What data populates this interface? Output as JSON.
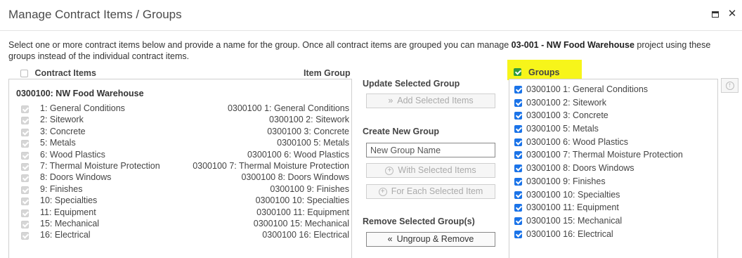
{
  "window": {
    "title": "Manage Contract Items / Groups",
    "maximize_icon": "maximize-icon",
    "close_label": "✕"
  },
  "description": {
    "before": "Select one or more contract items below and provide a name for the group. Once all contract items are grouped you can manage ",
    "project": "03-001 - NW Food Warehouse",
    "after": " project using these groups instead of the individual contract items."
  },
  "left": {
    "header_label": "Contract Items",
    "header_right": "Item Group",
    "group_title": "0300100: NW Food Warehouse",
    "items": [
      {
        "name": "1: General Conditions",
        "group": "0300100 1: General Conditions"
      },
      {
        "name": "2: Sitework",
        "group": "0300100 2: Sitework"
      },
      {
        "name": "3: Concrete",
        "group": "0300100 3: Concrete"
      },
      {
        "name": "5: Metals",
        "group": "0300100 5: Metals"
      },
      {
        "name": "6: Wood Plastics",
        "group": "0300100 6: Wood Plastics"
      },
      {
        "name": "7: Thermal Moisture Protection",
        "group": "0300100 7: Thermal Moisture Protection"
      },
      {
        "name": "8: Doors Windows",
        "group": "0300100 8: Doors Windows"
      },
      {
        "name": "9: Finishes",
        "group": "0300100 9: Finishes"
      },
      {
        "name": "10: Specialties",
        "group": "0300100 10: Specialties"
      },
      {
        "name": "11: Equipment",
        "group": "0300100 11: Equipment"
      },
      {
        "name": "15: Mechanical",
        "group": "0300100 15: Mechanical"
      },
      {
        "name": "16: Electrical",
        "group": "0300100 16: Electrical"
      }
    ]
  },
  "middle": {
    "update_label": "Update Selected Group",
    "add_selected_label": "Add Selected Items",
    "add_selected_icon": "»",
    "create_label": "Create New Group",
    "new_group_placeholder": "New Group Name",
    "with_selected_label": "With Selected Items",
    "for_each_label": "For Each Selected Item",
    "plus_icon": "+",
    "remove_label": "Remove Selected Group(s)",
    "ungroup_label": "Ungroup & Remove",
    "ungroup_icon": "«"
  },
  "right": {
    "header_label": "Groups",
    "highlight_color": "#f7f51a",
    "groups": [
      "0300100 1: General Conditions",
      "0300100 2: Sitework",
      "0300100 3: Concrete",
      "0300100 5: Metals",
      "0300100 6: Wood Plastics",
      "0300100 7: Thermal Moisture Protection",
      "0300100 8: Doors Windows",
      "0300100 9: Finishes",
      "0300100 10: Specialties",
      "0300100 11: Equipment",
      "0300100 15: Mechanical",
      "0300100 16: Electrical"
    ],
    "up_icon": "↑"
  }
}
